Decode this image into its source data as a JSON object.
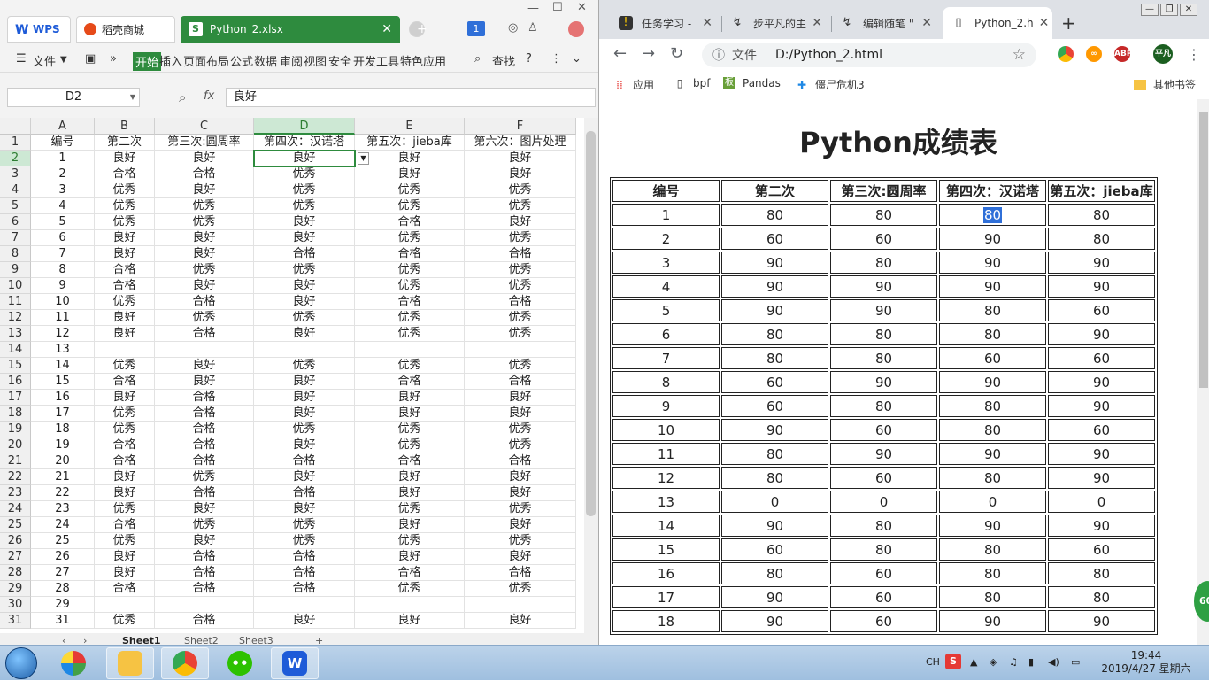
{
  "wps": {
    "tabs": {
      "wps": "WPS",
      "store": "稻壳商城",
      "file": "Python_2.xlsx"
    },
    "badge": "1",
    "menu": {
      "file": "文件",
      "start": "开始",
      "items": [
        "插入",
        "页面布局",
        "公式",
        "数据",
        "审阅",
        "视图",
        "安全",
        "开发工具",
        "特色应用"
      ],
      "search": "查找",
      "help": "?"
    },
    "name_box": "D2",
    "fx": "fx",
    "formula_value": "良好",
    "columns": [
      "A",
      "B",
      "C",
      "D",
      "E",
      "F"
    ],
    "rows": [
      [
        "编号",
        "第二次",
        "第三次:圆周率",
        "第四次：汉诺塔",
        "第五次：jieba库",
        "第六次：图片处理"
      ],
      [
        "1",
        "良好",
        "良好",
        "良好",
        "良好",
        "良好"
      ],
      [
        "2",
        "合格",
        "合格",
        "优秀",
        "良好",
        "良好"
      ],
      [
        "3",
        "优秀",
        "良好",
        "优秀",
        "优秀",
        "优秀"
      ],
      [
        "4",
        "优秀",
        "优秀",
        "优秀",
        "优秀",
        "优秀"
      ],
      [
        "5",
        "优秀",
        "优秀",
        "良好",
        "合格",
        "良好"
      ],
      [
        "6",
        "良好",
        "良好",
        "良好",
        "优秀",
        "优秀"
      ],
      [
        "7",
        "良好",
        "良好",
        "合格",
        "合格",
        "合格"
      ],
      [
        "8",
        "合格",
        "优秀",
        "优秀",
        "优秀",
        "优秀"
      ],
      [
        "9",
        "合格",
        "良好",
        "良好",
        "优秀",
        "优秀"
      ],
      [
        "10",
        "优秀",
        "合格",
        "良好",
        "合格",
        "合格"
      ],
      [
        "11",
        "良好",
        "优秀",
        "优秀",
        "优秀",
        "优秀"
      ],
      [
        "12",
        "良好",
        "合格",
        "良好",
        "优秀",
        "优秀"
      ],
      [
        "13",
        "",
        "",
        "",
        "",
        ""
      ],
      [
        "14",
        "优秀",
        "良好",
        "优秀",
        "优秀",
        "优秀"
      ],
      [
        "15",
        "合格",
        "良好",
        "良好",
        "合格",
        "合格"
      ],
      [
        "16",
        "良好",
        "合格",
        "良好",
        "良好",
        "良好"
      ],
      [
        "17",
        "优秀",
        "合格",
        "良好",
        "良好",
        "良好"
      ],
      [
        "18",
        "优秀",
        "合格",
        "优秀",
        "优秀",
        "优秀"
      ],
      [
        "19",
        "合格",
        "合格",
        "良好",
        "优秀",
        "优秀"
      ],
      [
        "20",
        "合格",
        "合格",
        "合格",
        "合格",
        "合格"
      ],
      [
        "21",
        "良好",
        "优秀",
        "良好",
        "良好",
        "良好"
      ],
      [
        "22",
        "良好",
        "合格",
        "合格",
        "良好",
        "良好"
      ],
      [
        "23",
        "优秀",
        "良好",
        "良好",
        "优秀",
        "优秀"
      ],
      [
        "24",
        "合格",
        "优秀",
        "优秀",
        "良好",
        "良好"
      ],
      [
        "25",
        "优秀",
        "良好",
        "优秀",
        "优秀",
        "优秀"
      ],
      [
        "26",
        "良好",
        "合格",
        "合格",
        "良好",
        "良好"
      ],
      [
        "27",
        "良好",
        "合格",
        "合格",
        "合格",
        "合格"
      ],
      [
        "28",
        "合格",
        "合格",
        "合格",
        "优秀",
        "优秀"
      ],
      [
        "29",
        "",
        "",
        "",
        "",
        ""
      ],
      [
        "31",
        "优秀",
        "合格",
        "良好",
        "良好",
        "良好"
      ]
    ],
    "sheets": [
      "Sheet1",
      "Sheet2",
      "Sheet3"
    ]
  },
  "chrome": {
    "tabs": [
      "任务学习 -",
      "步平凡的主",
      "编辑随笔 \"",
      "Python_2.h"
    ],
    "address_prefix": "文件",
    "address": "D:/Python_2.html",
    "profile": "平凡",
    "bookmarks": [
      "应用",
      "bpf",
      "Pandas",
      "僵尸危机3"
    ],
    "other_bookmarks": "其他书签",
    "page": {
      "title": "Python成绩表",
      "headers": [
        "编号",
        "第二次",
        "第三次:圆周率",
        "第四次：汉诺塔",
        "第五次：jieba库"
      ],
      "rows": [
        [
          "1",
          "80",
          "80",
          "80",
          "80"
        ],
        [
          "2",
          "60",
          "60",
          "90",
          "80"
        ],
        [
          "3",
          "90",
          "80",
          "90",
          "90"
        ],
        [
          "4",
          "90",
          "90",
          "90",
          "90"
        ],
        [
          "5",
          "90",
          "90",
          "80",
          "60"
        ],
        [
          "6",
          "80",
          "80",
          "80",
          "90"
        ],
        [
          "7",
          "80",
          "80",
          "60",
          "60"
        ],
        [
          "8",
          "60",
          "90",
          "90",
          "90"
        ],
        [
          "9",
          "60",
          "80",
          "80",
          "90"
        ],
        [
          "10",
          "90",
          "60",
          "80",
          "60"
        ],
        [
          "11",
          "80",
          "90",
          "90",
          "90"
        ],
        [
          "12",
          "80",
          "60",
          "80",
          "90"
        ],
        [
          "13",
          "0",
          "0",
          "0",
          "0"
        ],
        [
          "14",
          "90",
          "80",
          "90",
          "90"
        ],
        [
          "15",
          "60",
          "80",
          "80",
          "60"
        ],
        [
          "16",
          "80",
          "60",
          "80",
          "80"
        ],
        [
          "17",
          "90",
          "60",
          "80",
          "80"
        ],
        [
          "18",
          "90",
          "60",
          "90",
          "90"
        ]
      ]
    },
    "side_badge": "60"
  },
  "taskbar": {
    "lang": "CH",
    "time": "19:44",
    "date": "2019/4/27 星期六"
  },
  "colors": {
    "wps_green": "#2e8b3e",
    "selection_blue": "#2f6fd8"
  }
}
